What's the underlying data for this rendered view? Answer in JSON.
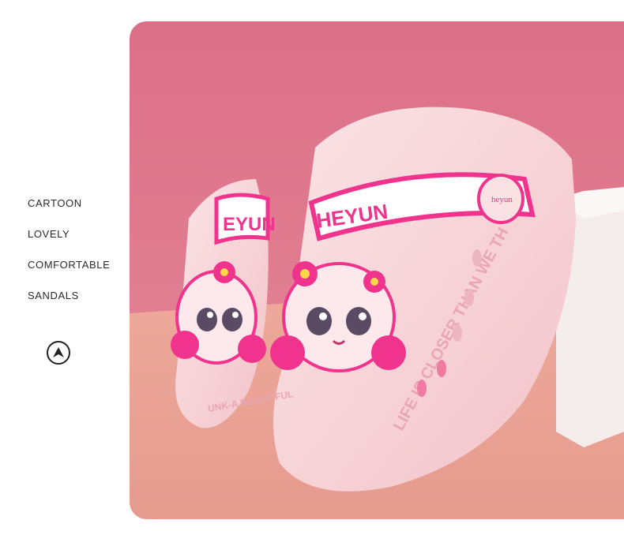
{
  "features": [
    "CARTOON",
    "LOVELY",
    "COMFORTABLE",
    "SANDALS"
  ],
  "badge_icon": "up-arrow-circle-icon",
  "product": {
    "strap_text": "HEYUN",
    "strap_text_left": "EYUN",
    "side_text": "LIFE IS CLOSER THAN WE TH",
    "side_text_left": "UNK-A BEAUTIFUL",
    "button_text": "heyun"
  },
  "colors": {
    "backdrop_top": "#dc6f88",
    "backdrop_floor": "#e9a598",
    "sandal": "#f7d3d6",
    "accent": "#f0348d"
  }
}
